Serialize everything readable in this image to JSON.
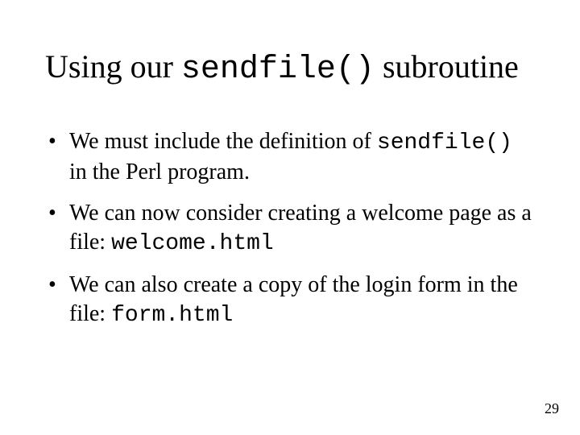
{
  "title": {
    "t1": "Using our ",
    "code": "sendfile()",
    "t2": " subroutine"
  },
  "bullets": [
    {
      "a": "We must include the definition of ",
      "code": "sendfile()",
      "b": " in the Perl program."
    },
    {
      "a": "We can now consider creating a welcome page as a file: ",
      "code": "welcome.html",
      "b": ""
    },
    {
      "a": "We can also create a copy of the login form in the file: ",
      "code": "form.html",
      "b": ""
    }
  ],
  "page_number": "29"
}
